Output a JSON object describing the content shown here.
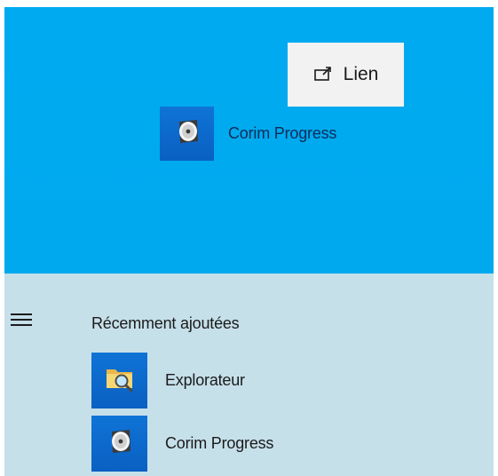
{
  "drag": {
    "tooltip_label": "Lien",
    "tooltip_icon": "link-shortcut-icon",
    "app_name": "Corim Progress",
    "app_icon": "disc-icon"
  },
  "start_menu": {
    "menu_icon": "hamburger-icon",
    "section_title": "Récemment ajoutées",
    "apps": [
      {
        "label": "Explorateur",
        "icon": "folder-search-icon"
      },
      {
        "label": "Corim Progress",
        "icon": "disc-icon"
      }
    ]
  },
  "colors": {
    "drag_area": "#00a9ef",
    "start_pane": "#c6e0ea",
    "tile": "#0a6ed1",
    "tooltip_bg": "#f2f2f2"
  }
}
